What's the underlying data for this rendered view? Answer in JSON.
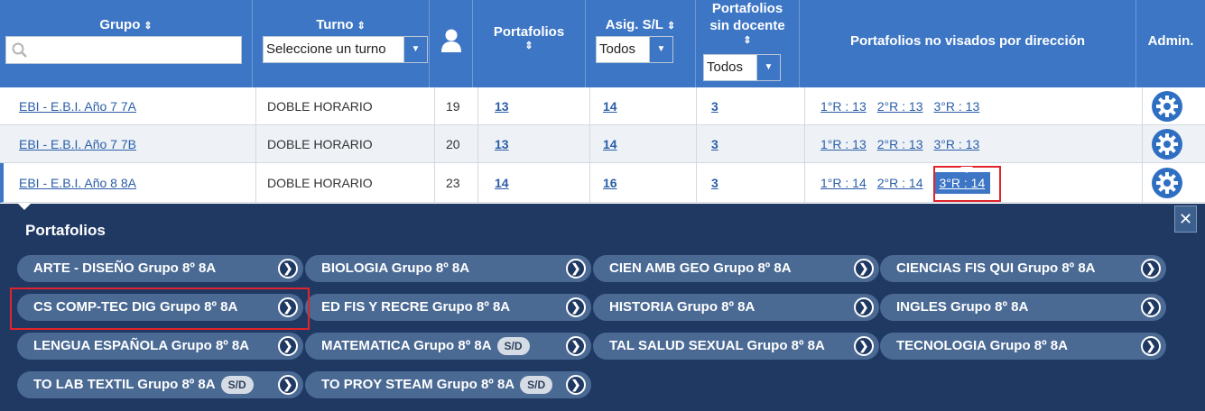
{
  "colors": {
    "header": "#3d76c5",
    "panel": "#1f3963",
    "pill": "#4a6a94",
    "link": "#2a5ea8",
    "highlight": "#e0232c"
  },
  "header": {
    "grupo": "Grupo",
    "turno": "Turno",
    "turno_select": "Seleccione un turno",
    "alumnos_icon": "user-icon",
    "portafolios": "Portafolios",
    "asig": "Asig. S/L",
    "asig_select": "Todos",
    "sin_docente_1": "Portafolios",
    "sin_docente_2": "sin docente",
    "sin_docente_select": "Todos",
    "no_visados": "Portafolios no visados por dirección",
    "admin": "Admin."
  },
  "rows": [
    {
      "grupo": "EBI - E.B.I. Año 7 7A",
      "turno": "DOBLE HORARIO",
      "alumnos": "19",
      "portafolios": "13",
      "asig": "14",
      "sin_docente": "3",
      "r1": "1°R : 13",
      "r2": "2°R : 13",
      "r3": "3°R : 13"
    },
    {
      "grupo": "EBI - E.B.I. Año 7 7B",
      "turno": "DOBLE HORARIO",
      "alumnos": "20",
      "portafolios": "13",
      "asig": "14",
      "sin_docente": "3",
      "r1": "1°R : 13",
      "r2": "2°R : 13",
      "r3": "3°R : 13"
    },
    {
      "grupo": "EBI - E.B.I. Año 8 8A",
      "turno": "DOBLE HORARIO",
      "alumnos": "23",
      "portafolios": "14",
      "asig": "16",
      "sin_docente": "3",
      "r1": "1°R : 14",
      "r2": "2°R : 14",
      "r3": "3°R : 14"
    }
  ],
  "panel": {
    "title": "Portafolios",
    "close": "✕",
    "sd_label": "S/D",
    "items": [
      {
        "label": "ARTE - DISEÑO Grupo 8º 8A"
      },
      {
        "label": "BIOLOGIA Grupo 8º 8A"
      },
      {
        "label": "CIEN AMB GEO Grupo 8º 8A"
      },
      {
        "label": "CIENCIAS FIS QUI Grupo 8º 8A"
      },
      {
        "label": "CS COMP-TEC DIG Grupo 8º 8A"
      },
      {
        "label": "ED FIS Y RECRE Grupo 8º 8A"
      },
      {
        "label": "HISTORIA Grupo 8º 8A"
      },
      {
        "label": "INGLES Grupo 8º 8A"
      },
      {
        "label": "LENGUA ESPAÑOLA Grupo 8º 8A"
      },
      {
        "label": "MATEMATICA Grupo 8º 8A"
      },
      {
        "label": "TAL SALUD SEXUAL Grupo 8º 8A"
      },
      {
        "label": "TECNOLOGIA Grupo 8º 8A"
      },
      {
        "label": "TO LAB TEXTIL Grupo 8º 8A"
      },
      {
        "label": "TO PROY STEAM Grupo 8º 8A"
      }
    ]
  }
}
